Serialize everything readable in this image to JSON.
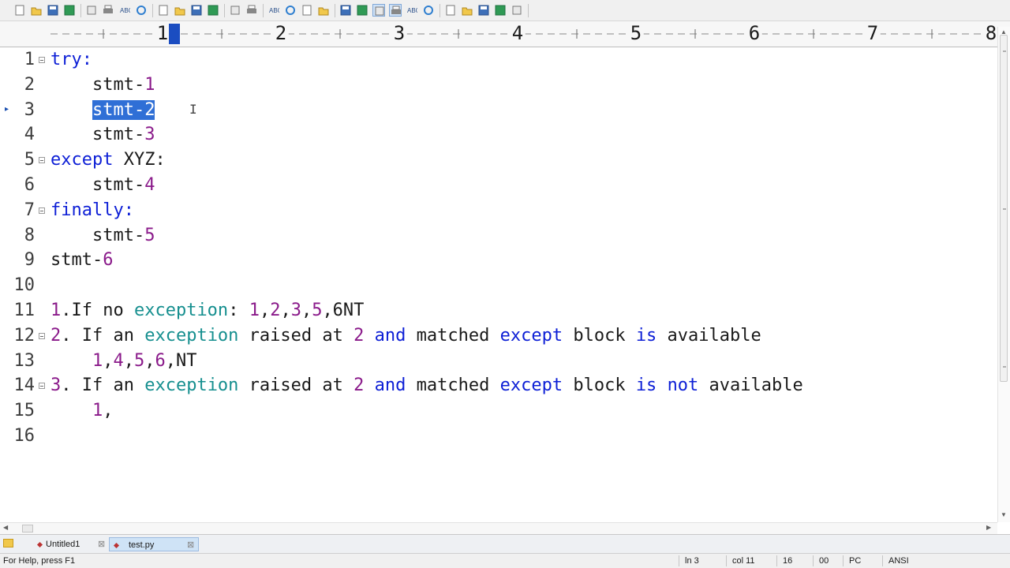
{
  "ruler": {
    "numbers": [
      "1",
      "2",
      "3",
      "4",
      "5",
      "6",
      "7",
      "8"
    ]
  },
  "editor": {
    "current_line": 3,
    "lines": [
      {
        "num": "1",
        "fold": true,
        "tokens": [
          {
            "text": "try:",
            "type": "keyword"
          }
        ]
      },
      {
        "num": "2",
        "tokens": [
          {
            "text": "    stmt-",
            "type": "default"
          },
          {
            "text": "1",
            "type": "number"
          }
        ]
      },
      {
        "num": "3",
        "bookmark": true,
        "tokens": [
          {
            "text": "    ",
            "type": "default"
          },
          {
            "text": "stmt-2",
            "type": "selected"
          }
        ]
      },
      {
        "num": "4",
        "tokens": [
          {
            "text": "    stmt-",
            "type": "default"
          },
          {
            "text": "3",
            "type": "number"
          }
        ]
      },
      {
        "num": "5",
        "fold": true,
        "tokens": [
          {
            "text": "except",
            "type": "keyword"
          },
          {
            "text": " XYZ:",
            "type": "default"
          }
        ]
      },
      {
        "num": "6",
        "tokens": [
          {
            "text": "    stmt-",
            "type": "default"
          },
          {
            "text": "4",
            "type": "number"
          }
        ]
      },
      {
        "num": "7",
        "fold": true,
        "tokens": [
          {
            "text": "finally:",
            "type": "keyword"
          }
        ]
      },
      {
        "num": "8",
        "tokens": [
          {
            "text": "    stmt-",
            "type": "default"
          },
          {
            "text": "5",
            "type": "number"
          }
        ]
      },
      {
        "num": "9",
        "tokens": [
          {
            "text": "stmt-",
            "type": "default"
          },
          {
            "text": "6",
            "type": "number"
          }
        ]
      },
      {
        "num": "10",
        "tokens": []
      },
      {
        "num": "11",
        "tokens": [
          {
            "text": "1",
            "type": "number"
          },
          {
            "text": ".If no ",
            "type": "default"
          },
          {
            "text": "exception",
            "type": "ident"
          },
          {
            "text": ": ",
            "type": "default"
          },
          {
            "text": "1",
            "type": "number"
          },
          {
            "text": ",",
            "type": "default"
          },
          {
            "text": "2",
            "type": "number"
          },
          {
            "text": ",",
            "type": "default"
          },
          {
            "text": "3",
            "type": "number"
          },
          {
            "text": ",",
            "type": "default"
          },
          {
            "text": "5",
            "type": "number"
          },
          {
            "text": ",6NT",
            "type": "default"
          }
        ]
      },
      {
        "num": "12",
        "fold": true,
        "tokens": [
          {
            "text": "2",
            "type": "number"
          },
          {
            "text": ". If an ",
            "type": "default"
          },
          {
            "text": "exception",
            "type": "ident"
          },
          {
            "text": " raised at ",
            "type": "default"
          },
          {
            "text": "2",
            "type": "number"
          },
          {
            "text": " ",
            "type": "default"
          },
          {
            "text": "and",
            "type": "keyword"
          },
          {
            "text": " matched ",
            "type": "default"
          },
          {
            "text": "except",
            "type": "keyword"
          },
          {
            "text": " block ",
            "type": "default"
          },
          {
            "text": "is",
            "type": "keyword"
          },
          {
            "text": " available",
            "type": "default"
          }
        ]
      },
      {
        "num": "13",
        "tokens": [
          {
            "text": "    ",
            "type": "default"
          },
          {
            "text": "1",
            "type": "number"
          },
          {
            "text": ",",
            "type": "default"
          },
          {
            "text": "4",
            "type": "number"
          },
          {
            "text": ",",
            "type": "default"
          },
          {
            "text": "5",
            "type": "number"
          },
          {
            "text": ",",
            "type": "default"
          },
          {
            "text": "6",
            "type": "number"
          },
          {
            "text": ",NT",
            "type": "default"
          }
        ]
      },
      {
        "num": "14",
        "fold": true,
        "tokens": [
          {
            "text": "3",
            "type": "number"
          },
          {
            "text": ". If an ",
            "type": "default"
          },
          {
            "text": "exception",
            "type": "ident"
          },
          {
            "text": " raised at ",
            "type": "default"
          },
          {
            "text": "2",
            "type": "number"
          },
          {
            "text": " ",
            "type": "default"
          },
          {
            "text": "and",
            "type": "keyword"
          },
          {
            "text": " matched ",
            "type": "default"
          },
          {
            "text": "except",
            "type": "keyword"
          },
          {
            "text": " block ",
            "type": "default"
          },
          {
            "text": "is",
            "type": "keyword"
          },
          {
            "text": " ",
            "type": "default"
          },
          {
            "text": "not",
            "type": "keyword"
          },
          {
            "text": " available",
            "type": "default"
          }
        ]
      },
      {
        "num": "15",
        "tokens": [
          {
            "text": "    ",
            "type": "default"
          },
          {
            "text": "1",
            "type": "number"
          },
          {
            "text": ",",
            "type": "default"
          }
        ]
      },
      {
        "num": "16",
        "tokens": []
      }
    ]
  },
  "toolbar": {
    "icons": [
      "new-file-icon",
      "open-file-icon",
      "save-icon",
      "save-all-icon",
      "print-preview-icon",
      "print-icon",
      "spell-check-icon",
      "refresh-icon",
      "cut-icon",
      "copy-icon",
      "paste-icon",
      "delete-icon",
      "undo-icon",
      "redo-icon",
      "find-icon",
      "replace-icon",
      "find-in-files-icon",
      "goto-icon",
      "font-icon",
      "hex-icon",
      "word-wrap-icon",
      "column-mode-icon",
      "list-icon",
      "spell-check-mark-icon",
      "tag-list-icon",
      "file-tree-icon",
      "function-list-icon",
      "output-window-icon",
      "help-icon"
    ]
  },
  "tabs": [
    {
      "label": "Untitled1",
      "active": false
    },
    {
      "label": "test.py",
      "active": true
    }
  ],
  "status": {
    "help": "For Help, press F1",
    "line": "ln 3",
    "col": "col 11",
    "size": "16",
    "code": "00",
    "eol": "PC",
    "encoding": "ANSI"
  },
  "colors": {
    "keyword": "#0d1fd6",
    "number": "#8a1a8a",
    "identifier": "#168f8f",
    "selection": "#2f6fd6",
    "text": "#1a1a1a"
  }
}
